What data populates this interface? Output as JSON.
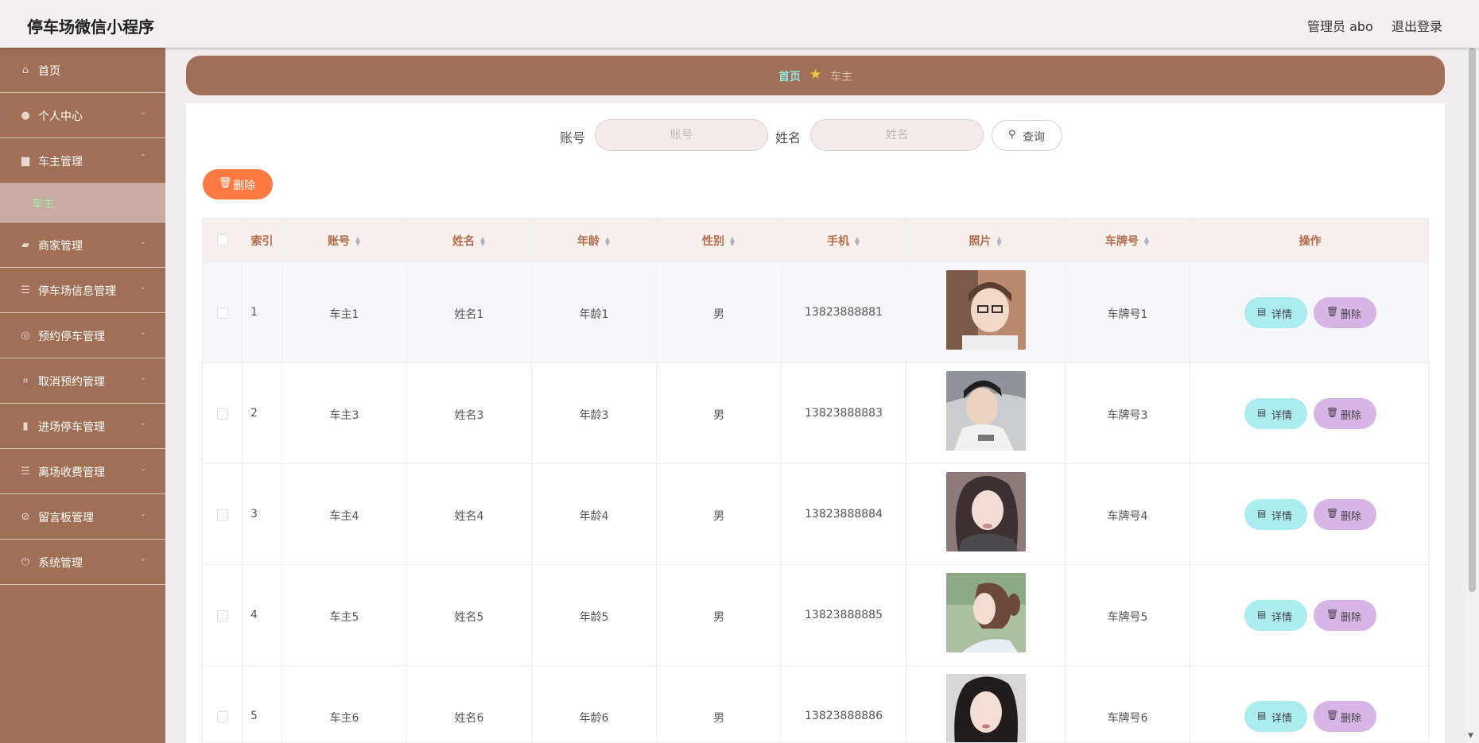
{
  "header": {
    "title": "停车场微信小程序",
    "admin": "管理员 abo",
    "logout": "退出登录"
  },
  "sidebar": {
    "items": [
      {
        "label": "首页",
        "icon": "home-icon"
      },
      {
        "label": "个人中心",
        "icon": "user-icon"
      },
      {
        "label": "车主管理",
        "icon": "car-owner-icon"
      },
      {
        "label": "商家管理",
        "icon": "shop-icon"
      },
      {
        "label": "停车场信息管理",
        "icon": "list-icon"
      },
      {
        "label": "预约停车管理",
        "icon": "compass-icon"
      },
      {
        "label": "取消预约管理",
        "icon": "crop-icon"
      },
      {
        "label": "进场停车管理",
        "icon": "bar-chart-icon"
      },
      {
        "label": "离场收费管理",
        "icon": "list-icon"
      },
      {
        "label": "留言板管理",
        "icon": "no-camera-icon"
      },
      {
        "label": "系统管理",
        "icon": "power-icon"
      }
    ],
    "sub_item": "车主"
  },
  "breadcrumb": {
    "home": "首页",
    "current": "车主"
  },
  "search": {
    "account_label": "账号",
    "account_placeholder": "账号",
    "name_label": "姓名",
    "name_placeholder": "姓名",
    "query": "查询"
  },
  "actions": {
    "delete": "删除"
  },
  "table": {
    "columns": [
      "索引",
      "账号",
      "姓名",
      "年龄",
      "性别",
      "手机",
      "照片",
      "车牌号",
      "操作"
    ],
    "rows": [
      {
        "index": "1",
        "account": "车主1",
        "name": "姓名1",
        "age": "年龄1",
        "gender": "男",
        "phone": "13823888881",
        "plate": "车牌号1"
      },
      {
        "index": "2",
        "account": "车主3",
        "name": "姓名3",
        "age": "年龄3",
        "gender": "男",
        "phone": "13823888883",
        "plate": "车牌号3"
      },
      {
        "index": "3",
        "account": "车主4",
        "name": "姓名4",
        "age": "年龄4",
        "gender": "男",
        "phone": "13823888884",
        "plate": "车牌号4"
      },
      {
        "index": "4",
        "account": "车主5",
        "name": "姓名5",
        "age": "年龄5",
        "gender": "男",
        "phone": "13823888885",
        "plate": "车牌号5"
      },
      {
        "index": "5",
        "account": "车主6",
        "name": "姓名6",
        "age": "年龄6",
        "gender": "男",
        "phone": "13823888886",
        "plate": "车牌号6"
      }
    ],
    "detail_btn": "详情",
    "delete_btn": "删除"
  },
  "colors": {
    "sidebar": "#a06f56",
    "accent": "#ff7a43",
    "detail": "#abecef",
    "delete": "#d7b5e6"
  }
}
